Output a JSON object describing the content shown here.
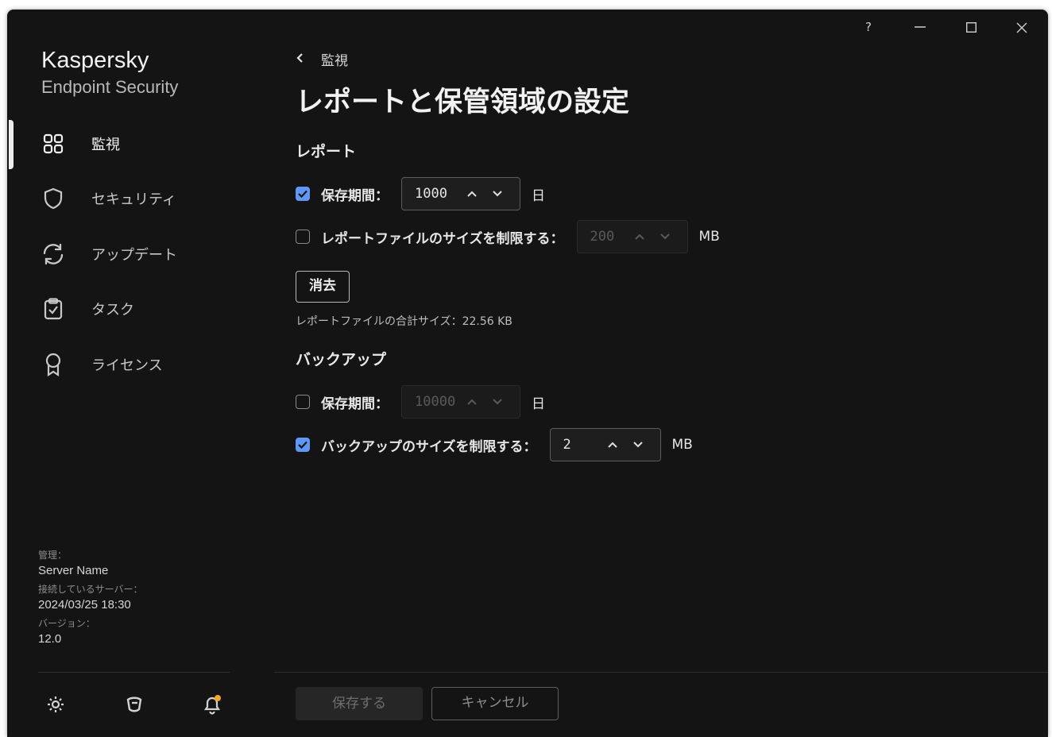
{
  "window": {
    "controls": {
      "help": "?"
    }
  },
  "brand": {
    "name": "Kaspersky",
    "product": "Endpoint Security"
  },
  "sidebar": {
    "items": [
      {
        "label": "監視",
        "icon": "monitoring-grid-icon",
        "active": true
      },
      {
        "label": "セキュリティ",
        "icon": "shield-icon"
      },
      {
        "label": "アップデート",
        "icon": "refresh-icon"
      },
      {
        "label": "タスク",
        "icon": "clipboard-check-icon"
      },
      {
        "label": "ライセンス",
        "icon": "license-ribbon-icon"
      }
    ],
    "info": {
      "managed_label": "管理：",
      "managed_value": "Server Name",
      "connected_label": "接続しているサーバー：",
      "connected_value": "2024/03/25 18:30",
      "version_label": "バージョン：",
      "version_value": "12.0"
    },
    "bottom_icons": [
      "settings-gear-icon",
      "support-icon",
      "notifications-bell-icon"
    ]
  },
  "main": {
    "breadcrumb": "監視",
    "title": "レポートと保管領域の設定",
    "reports": {
      "heading": "レポート",
      "retention": {
        "checked": true,
        "label": "保存期間：",
        "value": "1000",
        "unit": "日"
      },
      "size_limit": {
        "checked": false,
        "label": "レポートファイルのサイズを制限する：",
        "value": "200",
        "unit": "MB"
      },
      "clear_button": "消去",
      "total_size": "レポートファイルの合計サイズ：22.56 KB"
    },
    "backup": {
      "heading": "バックアップ",
      "retention": {
        "checked": false,
        "label": "保存期間：",
        "value": "10000",
        "unit": "日"
      },
      "size_limit": {
        "checked": true,
        "label": "バックアップのサイズを制限する：",
        "value": "2",
        "unit": "MB"
      }
    }
  },
  "footer": {
    "save": "保存する",
    "cancel": "キャンセル"
  },
  "colors": {
    "background": "#141414",
    "checkbox_accent": "#5f97f5",
    "notification_dot": "#f5a623"
  }
}
